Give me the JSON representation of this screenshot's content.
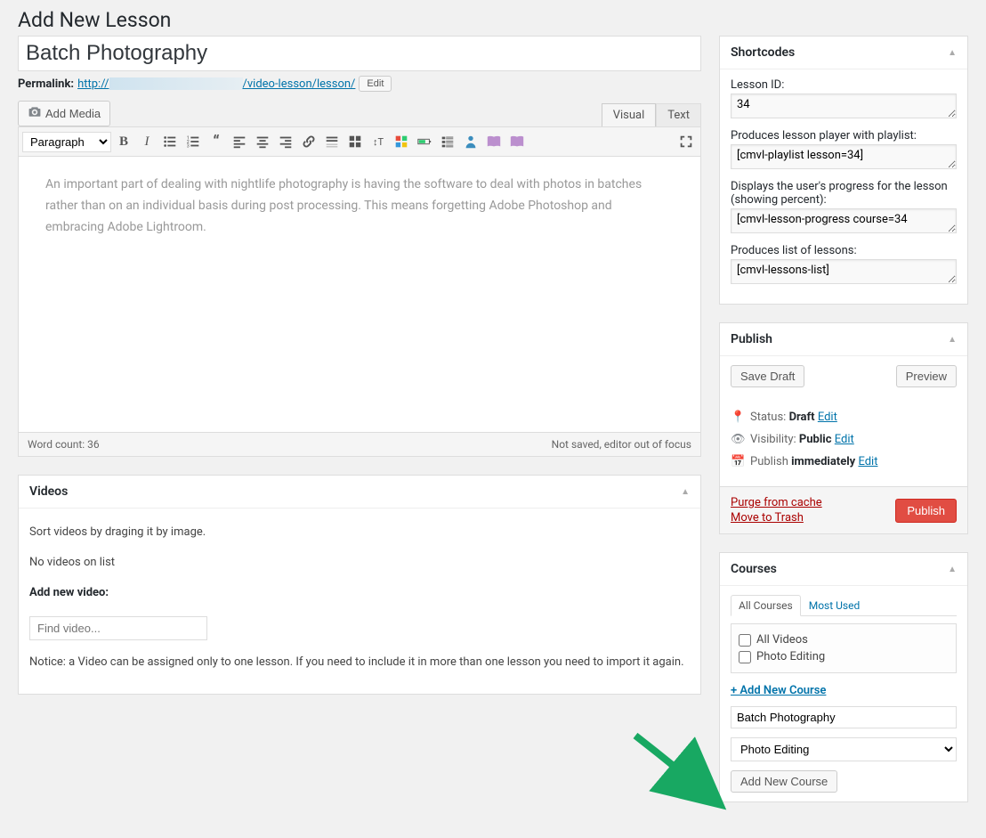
{
  "page_title": "Add New Lesson",
  "title_input": "Batch Photography",
  "permalink": {
    "label": "Permalink:",
    "prefix": "http://",
    "suffix": "/video-lesson/lesson/",
    "edit_label": "Edit"
  },
  "add_media_label": "Add Media",
  "editor_tabs": {
    "visual": "Visual",
    "text": "Text"
  },
  "format_select": "Paragraph",
  "editor_content": "An important part of dealing with nightlife photography is having the software to deal with photos in batches rather than on an individual basis during post processing. This means forgetting Adobe Photoshop and embracing Adobe Lightroom.",
  "editor_footer": {
    "wordcount": "Word count: 36",
    "status": "Not saved, editor out of focus"
  },
  "videos_panel": {
    "title": "Videos",
    "sort_hint": "Sort videos by draging it by image.",
    "empty": "No videos on list",
    "add_label": "Add new video:",
    "find_placeholder": "Find video...",
    "notice": "Notice: a Video can be assigned only to one lesson. If you need to include it in more than one lesson you need to import it again."
  },
  "shortcodes": {
    "title": "Shortcodes",
    "lesson_id_label": "Lesson ID:",
    "lesson_id_value": "34",
    "playlist_label": "Produces lesson player with playlist:",
    "playlist_value": "[cmvl-playlist lesson=34]",
    "progress_label": "Displays the user's progress for the lesson (showing percent):",
    "progress_value": "[cmvl-lesson-progress course=34",
    "list_label": "Produces list of lessons:",
    "list_value": "[cmvl-lessons-list]"
  },
  "publish": {
    "title": "Publish",
    "save_draft": "Save Draft",
    "preview": "Preview",
    "status_label": "Status:",
    "status_value": "Draft",
    "visibility_label": "Visibility:",
    "visibility_value": "Public",
    "schedule_label": "Publish",
    "schedule_value": "immediately",
    "edit_link": "Edit",
    "purge_link": "Purge from cache",
    "trash_link": "Move to Trash",
    "publish_btn": "Publish"
  },
  "courses": {
    "title": "Courses",
    "tab_all": "All Courses",
    "tab_most": "Most Used",
    "items": [
      "All Videos",
      "Photo Editing"
    ],
    "add_link": "+ Add New Course",
    "new_name": "Batch Photography",
    "parent_select": "Photo Editing",
    "add_btn": "Add New Course"
  }
}
